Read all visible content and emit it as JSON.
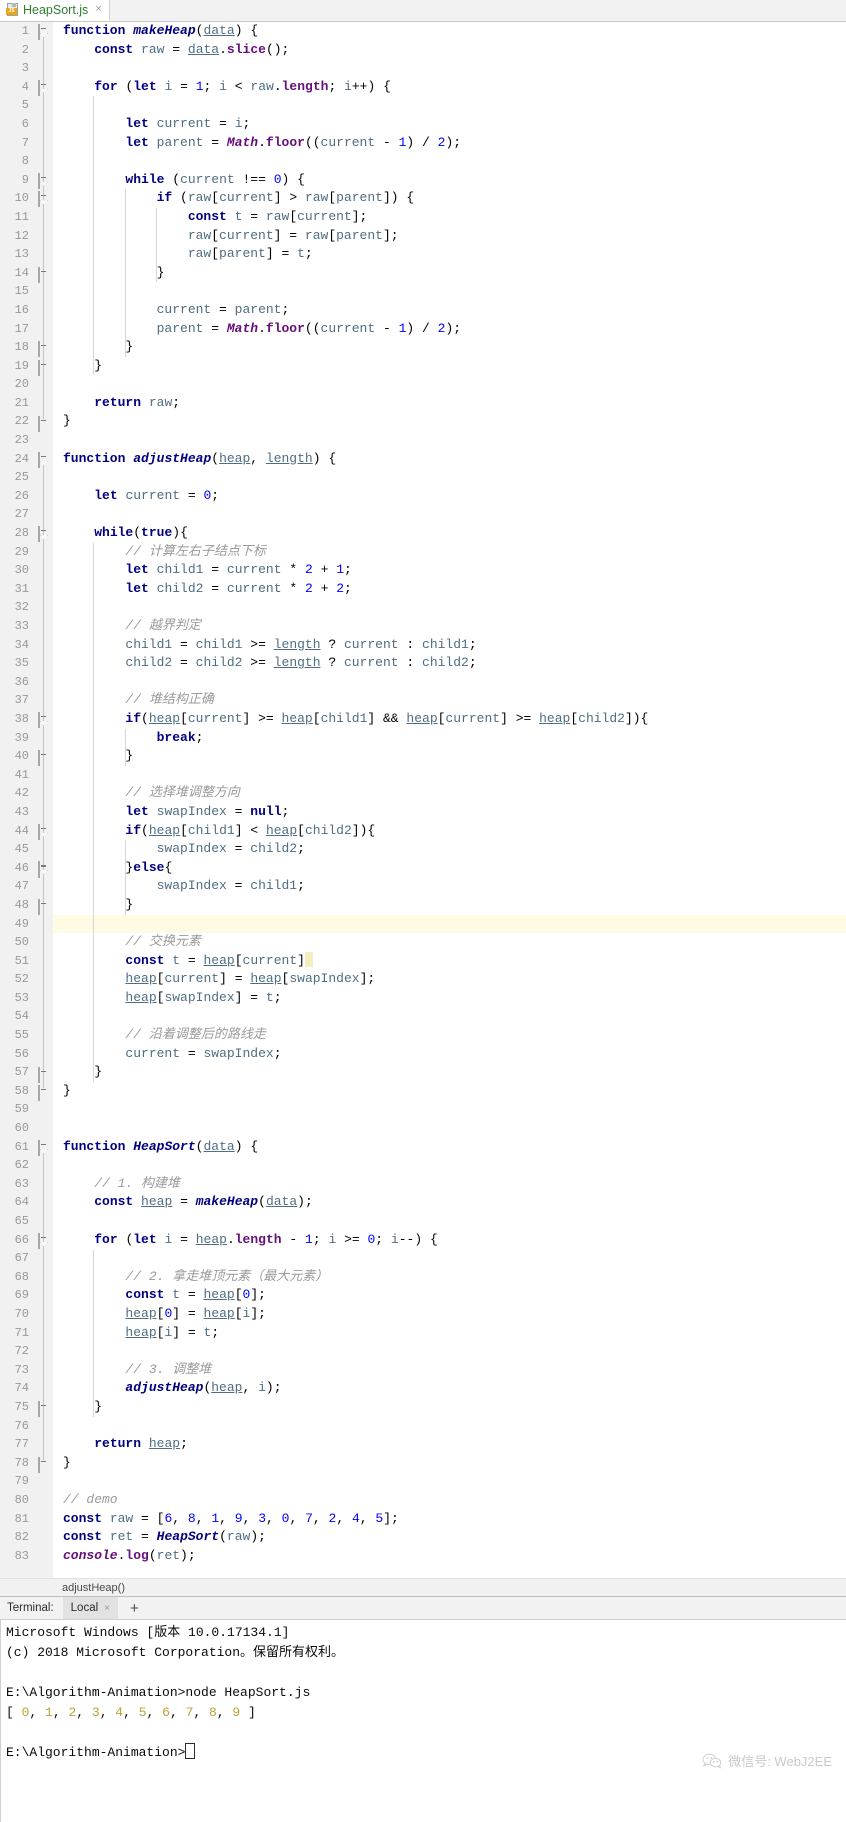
{
  "window": {
    "tab": {
      "label": "HeapSort.js",
      "icon": "js-file-icon",
      "close": "×"
    }
  },
  "editor": {
    "breadcrumb": "adjustHeap()",
    "highlight_line": 49,
    "cursor_line": 51,
    "total_lines": 83,
    "lines": [
      {
        "n": 1,
        "text": "function makeHeap(data) {"
      },
      {
        "n": 2,
        "text": "    const raw = data.slice();"
      },
      {
        "n": 3,
        "text": ""
      },
      {
        "n": 4,
        "text": "    for (let i = 1; i < raw.length; i++) {"
      },
      {
        "n": 5,
        "text": ""
      },
      {
        "n": 6,
        "text": "        let current = i;"
      },
      {
        "n": 7,
        "text": "        let parent = Math.floor((current - 1) / 2);"
      },
      {
        "n": 8,
        "text": ""
      },
      {
        "n": 9,
        "text": "        while (current !== 0) {"
      },
      {
        "n": 10,
        "text": "            if (raw[current] > raw[parent]) {"
      },
      {
        "n": 11,
        "text": "                const t = raw[current];"
      },
      {
        "n": 12,
        "text": "                raw[current] = raw[parent];"
      },
      {
        "n": 13,
        "text": "                raw[parent] = t;"
      },
      {
        "n": 14,
        "text": "            }"
      },
      {
        "n": 15,
        "text": ""
      },
      {
        "n": 16,
        "text": "            current = parent;"
      },
      {
        "n": 17,
        "text": "            parent = Math.floor((current - 1) / 2);"
      },
      {
        "n": 18,
        "text": "        }"
      },
      {
        "n": 19,
        "text": "    }"
      },
      {
        "n": 20,
        "text": ""
      },
      {
        "n": 21,
        "text": "    return raw;"
      },
      {
        "n": 22,
        "text": "}"
      },
      {
        "n": 23,
        "text": ""
      },
      {
        "n": 24,
        "text": "function adjustHeap(heap, length) {"
      },
      {
        "n": 25,
        "text": ""
      },
      {
        "n": 26,
        "text": "    let current = 0;"
      },
      {
        "n": 27,
        "text": ""
      },
      {
        "n": 28,
        "text": "    while(true){"
      },
      {
        "n": 29,
        "text": "        // 计算左右子结点下标"
      },
      {
        "n": 30,
        "text": "        let child1 = current * 2 + 1;"
      },
      {
        "n": 31,
        "text": "        let child2 = current * 2 + 2;"
      },
      {
        "n": 32,
        "text": ""
      },
      {
        "n": 33,
        "text": "        // 越界判定"
      },
      {
        "n": 34,
        "text": "        child1 = child1 >= length ? current : child1;"
      },
      {
        "n": 35,
        "text": "        child2 = child2 >= length ? current : child2;"
      },
      {
        "n": 36,
        "text": ""
      },
      {
        "n": 37,
        "text": "        // 堆结构正确"
      },
      {
        "n": 38,
        "text": "        if(heap[current] >= heap[child1] && heap[current] >= heap[child2]){"
      },
      {
        "n": 39,
        "text": "            break;"
      },
      {
        "n": 40,
        "text": "        }"
      },
      {
        "n": 41,
        "text": ""
      },
      {
        "n": 42,
        "text": "        // 选择堆调整方向"
      },
      {
        "n": 43,
        "text": "        let swapIndex = null;"
      },
      {
        "n": 44,
        "text": "        if(heap[child1] < heap[child2]){"
      },
      {
        "n": 45,
        "text": "            swapIndex = child2;"
      },
      {
        "n": 46,
        "text": "        }else{"
      },
      {
        "n": 47,
        "text": "            swapIndex = child1;"
      },
      {
        "n": 48,
        "text": "        }"
      },
      {
        "n": 49,
        "text": ""
      },
      {
        "n": 50,
        "text": "        // 交换元素"
      },
      {
        "n": 51,
        "text": "        const t = heap[current]"
      },
      {
        "n": 52,
        "text": "        heap[current] = heap[swapIndex];"
      },
      {
        "n": 53,
        "text": "        heap[swapIndex] = t;"
      },
      {
        "n": 54,
        "text": ""
      },
      {
        "n": 55,
        "text": "        // 沿着调整后的路线走"
      },
      {
        "n": 56,
        "text": "        current = swapIndex;"
      },
      {
        "n": 57,
        "text": "    }"
      },
      {
        "n": 58,
        "text": "}"
      },
      {
        "n": 59,
        "text": ""
      },
      {
        "n": 60,
        "text": ""
      },
      {
        "n": 61,
        "text": "function HeapSort(data) {"
      },
      {
        "n": 62,
        "text": ""
      },
      {
        "n": 63,
        "text": "    // 1. 构建堆"
      },
      {
        "n": 64,
        "text": "    const heap = makeHeap(data);"
      },
      {
        "n": 65,
        "text": ""
      },
      {
        "n": 66,
        "text": "    for (let i = heap.length - 1; i >= 0; i--) {"
      },
      {
        "n": 67,
        "text": ""
      },
      {
        "n": 68,
        "text": "        // 2. 拿走堆顶元素（最大元素）"
      },
      {
        "n": 69,
        "text": "        const t = heap[0];"
      },
      {
        "n": 70,
        "text": "        heap[0] = heap[i];"
      },
      {
        "n": 71,
        "text": "        heap[i] = t;"
      },
      {
        "n": 72,
        "text": ""
      },
      {
        "n": 73,
        "text": "        // 3. 调整堆"
      },
      {
        "n": 74,
        "text": "        adjustHeap(heap, i);"
      },
      {
        "n": 75,
        "text": "    }"
      },
      {
        "n": 76,
        "text": ""
      },
      {
        "n": 77,
        "text": "    return heap;"
      },
      {
        "n": 78,
        "text": "}"
      },
      {
        "n": 79,
        "text": ""
      },
      {
        "n": 80,
        "text": "// demo"
      },
      {
        "n": 81,
        "text": "const raw = [6, 8, 1, 9, 3, 0, 7, 2, 4, 5];"
      },
      {
        "n": 82,
        "text": "const ret = HeapSort(raw);"
      },
      {
        "n": 83,
        "text": "console.log(ret);"
      }
    ]
  },
  "terminal": {
    "label": "Terminal:",
    "tab": "Local",
    "tab_close": "×",
    "add": "+",
    "lines": [
      "Microsoft Windows [版本 10.0.17134.1]",
      "(c) 2018 Microsoft Corporation。保留所有权利。",
      "",
      "E:\\Algorithm-Animation>node HeapSort.js",
      "[ 0, 1, 2, 3, 4, 5, 6, 7, 8, 9 ]",
      "",
      "E:\\Algorithm-Animation>"
    ],
    "output_array": [
      0,
      1,
      2,
      3,
      4,
      5,
      6,
      7,
      8,
      9
    ],
    "prompt": "E:\\Algorithm-Animation>",
    "command": "node HeapSort.js",
    "version_line": "Microsoft Windows [版本 10.0.17134.1]",
    "copyright_line": "(c) 2018 Microsoft Corporation。保留所有权利。"
  },
  "watermark": {
    "text": "微信号: WebJ2EE",
    "icon": "wechat-icon"
  },
  "colors": {
    "keyword": "#000080",
    "identifier": "#4f6e82",
    "number": "#0000ff",
    "comment": "#9a9a9a",
    "property": "#660e7a",
    "tab_label": "#2e7d32",
    "gutter_bg": "#f1f1f1",
    "highlight_bg": "#fffae3",
    "terminal_number": "#b8a23a"
  }
}
